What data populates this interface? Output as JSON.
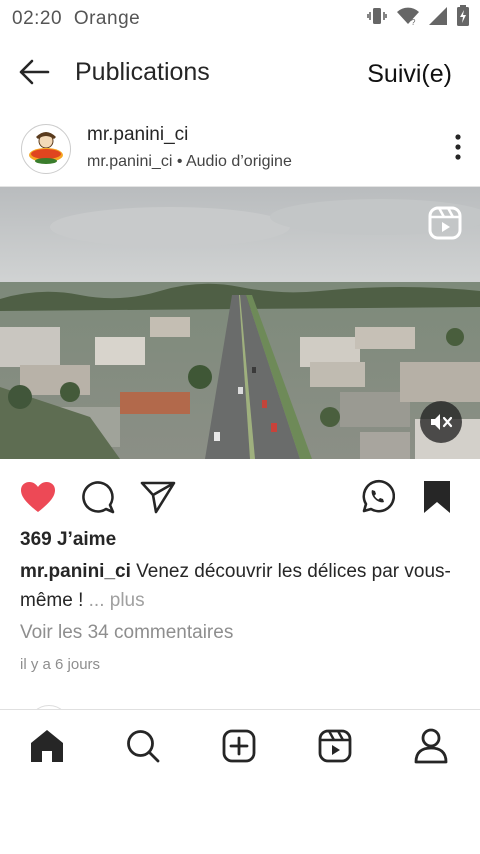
{
  "status_bar": {
    "time": "02:20",
    "carrier": "Orange",
    "icons": [
      "vibrate-icon",
      "wifi-icon",
      "signal-icon",
      "battery-icon"
    ]
  },
  "header": {
    "back_icon": "arrow-left-icon",
    "title": "Publications",
    "follow_label": "Suivi(e)"
  },
  "post": {
    "avatar_logo_text": "mr.panini",
    "username": "mr.panini_ci",
    "audio_owner": "mr.panini_ci",
    "audio_separator": " • ",
    "audio_label": "Audio d’origine",
    "more_icon": "more-vertical-icon",
    "media_icons": [
      "reels-icon",
      "muted-speaker-icon"
    ],
    "actions": [
      "heart-icon",
      "comment-icon",
      "share-icon",
      "whatsapp-icon",
      "bookmark-icon"
    ],
    "likes": "369 J’aime",
    "caption_user": "mr.panini_ci",
    "caption_text": " Venez découvrir les délices par vous-même !",
    "caption_more": " ... plus",
    "comments_link": "Voir les 34 commentaires",
    "time_ago": "il y a 6 jours"
  },
  "bottom_nav": [
    "home-icon",
    "search-icon",
    "create-icon",
    "reels-icon",
    "profile-icon"
  ],
  "colors": {
    "like_red": "#ed4956",
    "text_primary": "#262626",
    "text_secondary": "#8e8e8e"
  }
}
